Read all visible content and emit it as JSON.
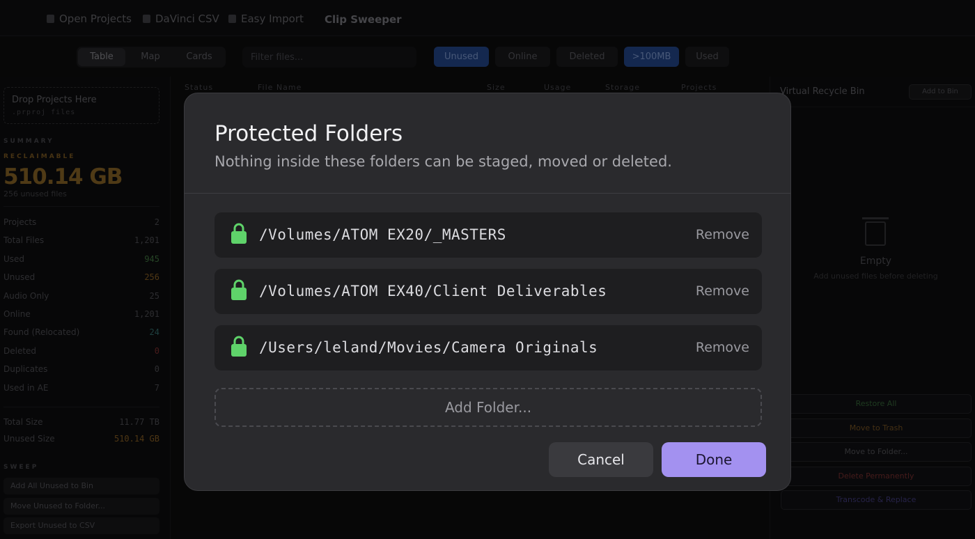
{
  "menu": {
    "items": [
      "Open Projects",
      "DaVinci CSV",
      "Easy Import"
    ],
    "app_title": "Clip Sweeper"
  },
  "toolbar": {
    "views": [
      "Table",
      "Map",
      "Cards"
    ],
    "active_view": "Table",
    "filter_placeholder": "Filter files...",
    "chips": [
      "Unused",
      "Online",
      "Deleted",
      ">100MB",
      "Used"
    ],
    "active_chips": [
      "Unused",
      ">100MB"
    ]
  },
  "table": {
    "columns": [
      "Status",
      "File Name",
      "Size",
      "Usage",
      "Storage",
      "Projects"
    ]
  },
  "sidebar": {
    "drop_title": "Drop Projects Here",
    "drop_hint": ".prproj files",
    "summary_label": "SUMMARY",
    "reclaimable_label": "RECLAIMABLE",
    "reclaimable_value": "510.14 GB",
    "reclaimable_sub": "256 unused files",
    "stats": [
      {
        "label": "Projects",
        "value": "2"
      },
      {
        "label": "Total Files",
        "value": "1,201"
      },
      {
        "label": "Used",
        "value": "945"
      },
      {
        "label": "Unused",
        "value": "256"
      },
      {
        "label": "Audio Only",
        "value": "25"
      },
      {
        "label": "Online",
        "value": "1,201"
      },
      {
        "label": "Found (Relocated)",
        "value": "24"
      },
      {
        "label": "Deleted",
        "value": "0"
      },
      {
        "label": "Duplicates",
        "value": "0"
      },
      {
        "label": "Used in AE",
        "value": "7"
      }
    ],
    "totals": [
      {
        "label": "Total Size",
        "value": "11.77 TB"
      },
      {
        "label": "Unused Size",
        "value": "510.14 GB"
      }
    ],
    "sweep_label": "SWEEP",
    "sweep_buttons": [
      "Add All Unused to Bin",
      "Move Unused to Folder...",
      "Export Unused to CSV"
    ]
  },
  "recycle_bin": {
    "title": "Virtual Recycle Bin",
    "add_button": "Add to Bin",
    "empty_title": "Empty",
    "empty_hint": "Add unused files before deleting",
    "actions": [
      "Restore All",
      "Move to Trash",
      "Move to Folder...",
      "Delete Permanently",
      "Transcode & Replace"
    ]
  },
  "modal": {
    "title": "Protected Folders",
    "subtitle": "Nothing inside these folders can be staged, moved or deleted.",
    "folders": [
      {
        "path": "/Volumes/ATOM EX20/_MASTERS",
        "remove_label": "Remove"
      },
      {
        "path": "/Volumes/ATOM EX40/Client Deliverables",
        "remove_label": "Remove"
      },
      {
        "path": "/Users/leland/Movies/Camera Originals",
        "remove_label": "Remove"
      }
    ],
    "add_folder_label": "Add Folder...",
    "cancel_label": "Cancel",
    "done_label": "Done"
  },
  "colors": {
    "accent_done": "#a391f0",
    "lock_green": "#5fd36a",
    "chip_blue": "#1f3e7a",
    "reclaimable_orange": "#7a5a22"
  }
}
